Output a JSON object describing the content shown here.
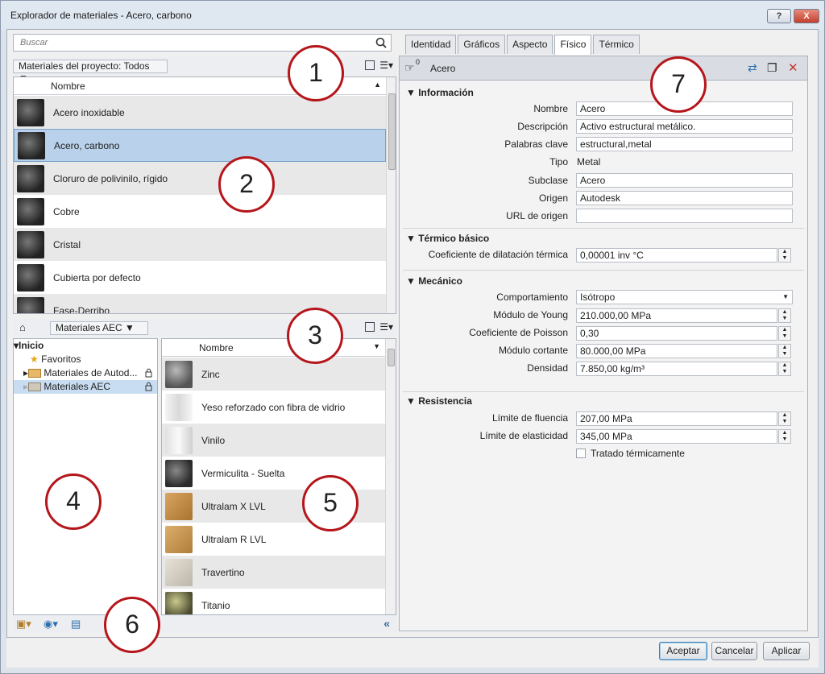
{
  "window": {
    "title": "Explorador de materiales - Acero, carbono",
    "help_label": "?",
    "close_label": "X"
  },
  "search": {
    "placeholder": "Buscar"
  },
  "project": {
    "breadcrumb": "Materiales del proyecto: Todos",
    "column_header": "Nombre",
    "items": [
      {
        "name": "Acero inoxidable"
      },
      {
        "name": "Acero, carbono"
      },
      {
        "name": "Cloruro de polivinilo, rígido"
      },
      {
        "name": "Cobre"
      },
      {
        "name": "Cristal"
      },
      {
        "name": "Cubierta por defecto"
      },
      {
        "name": "Fase-Derribo"
      }
    ]
  },
  "library": {
    "breadcrumb": "Materiales AEC",
    "column_header": "Nombre",
    "tree": [
      {
        "label": "Inicio"
      },
      {
        "label": "Favoritos"
      },
      {
        "label": "Materiales de Autod..."
      },
      {
        "label": "Materiales AEC"
      }
    ],
    "items": [
      {
        "name": "Zinc"
      },
      {
        "name": "Yeso reforzado con fibra de vidrio"
      },
      {
        "name": "Vinilo"
      },
      {
        "name": "Vermiculita - Suelta"
      },
      {
        "name": "Ultralam X LVL"
      },
      {
        "name": "Ultralam R LVL"
      },
      {
        "name": "Travertino"
      },
      {
        "name": "Titanio"
      }
    ]
  },
  "tabs": [
    "Identidad",
    "Gráficos",
    "Aspecto",
    "Físico",
    "Térmico"
  ],
  "asset": {
    "count": "0",
    "name": "Acero"
  },
  "info": {
    "title": "Información",
    "name_label": "Nombre",
    "name": "Acero",
    "desc_label": "Descripción",
    "desc": "Activo estructural metálico.",
    "keywords_label": "Palabras clave",
    "keywords": "estructural,metal",
    "type_label": "Tipo",
    "type": "Metal",
    "subclass_label": "Subclase",
    "subclass": "Acero",
    "source_label": "Origen",
    "source": "Autodesk",
    "url_label": "URL de origen",
    "url": ""
  },
  "thermal": {
    "title": "Térmico básico",
    "coef_label": "Coeficiente de dilatación térmica",
    "coef": "0,00001 inv °C"
  },
  "mechanical": {
    "title": "Mecánico",
    "behavior_label": "Comportamiento",
    "behavior": "Isótropo",
    "young_label": "Módulo de Young",
    "young": "210.000,00 MPa",
    "poisson_label": "Coeficiente de Poisson",
    "poisson": "0,30",
    "shear_label": "Módulo cortante",
    "shear": "80.000,00 MPa",
    "density_label": "Densidad",
    "density": "7.850,00 kg/m³"
  },
  "resistance": {
    "title": "Resistencia",
    "yield_label": "Límite de fluencia",
    "yield": "207,00 MPa",
    "elastic_label": "Límite de elasticidad",
    "elastic": "345,00 MPa",
    "treated_label": "Tratado térmicamente"
  },
  "buttons": {
    "ok": "Aceptar",
    "cancel": "Cancelar",
    "apply": "Aplicar"
  },
  "callouts": [
    "1",
    "2",
    "3",
    "4",
    "5",
    "6",
    "7"
  ]
}
